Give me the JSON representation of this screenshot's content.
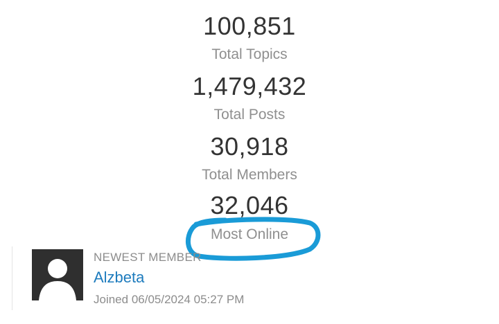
{
  "stats": [
    {
      "value": "100,851",
      "label": "Total Topics"
    },
    {
      "value": "1,479,432",
      "label": "Total Posts"
    },
    {
      "value": "30,918",
      "label": "Total Members"
    },
    {
      "value": "32,046",
      "label": "Most Online"
    }
  ],
  "highlight": {
    "color": "#1a9bd7",
    "target": "Most Online"
  },
  "newest_member": {
    "heading": "NEWEST MEMBER",
    "name": "Alzbeta",
    "joined": "Joined 06/05/2024 05:27 PM",
    "avatar_icon": "default-user-avatar-icon"
  },
  "colors": {
    "value_text": "#333333",
    "label_text": "#8f8f8f",
    "link": "#1d7bbd"
  }
}
